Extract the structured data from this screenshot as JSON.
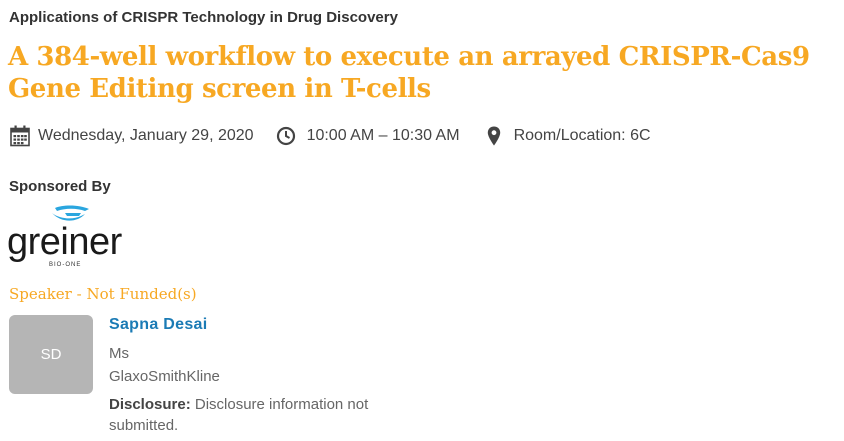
{
  "track": "Applications of CRISPR Technology in Drug Discovery",
  "title": "A 384-well workflow to execute an arrayed CRISPR-Cas9 Gene Editing screen in T-cells",
  "meta": {
    "date": "Wednesday, January 29, 2020",
    "time": "10:00 AM – 10:30 AM",
    "location": "Room/Location: 6C",
    "icons": [
      "calendar-icon",
      "clock-icon",
      "map-pin-icon"
    ]
  },
  "sponsor": {
    "heading": "Sponsored By",
    "logo_text": "greiner",
    "logo_subtext": "BIO-ONE"
  },
  "speaker_section": {
    "heading": "Speaker - Not Funded(s)",
    "speaker": {
      "initials": "SD",
      "name": "Sapna Desai",
      "title": "Ms",
      "organization": "GlaxoSmithKline",
      "disclosure_label": "Disclosure:",
      "disclosure_text": "Disclosure information not submitted."
    }
  },
  "colors": {
    "accent": "#f7a823",
    "link": "#1b7bb5",
    "logo_blue": "#2aa6df",
    "avatar_bg": "#b5b5b5"
  }
}
